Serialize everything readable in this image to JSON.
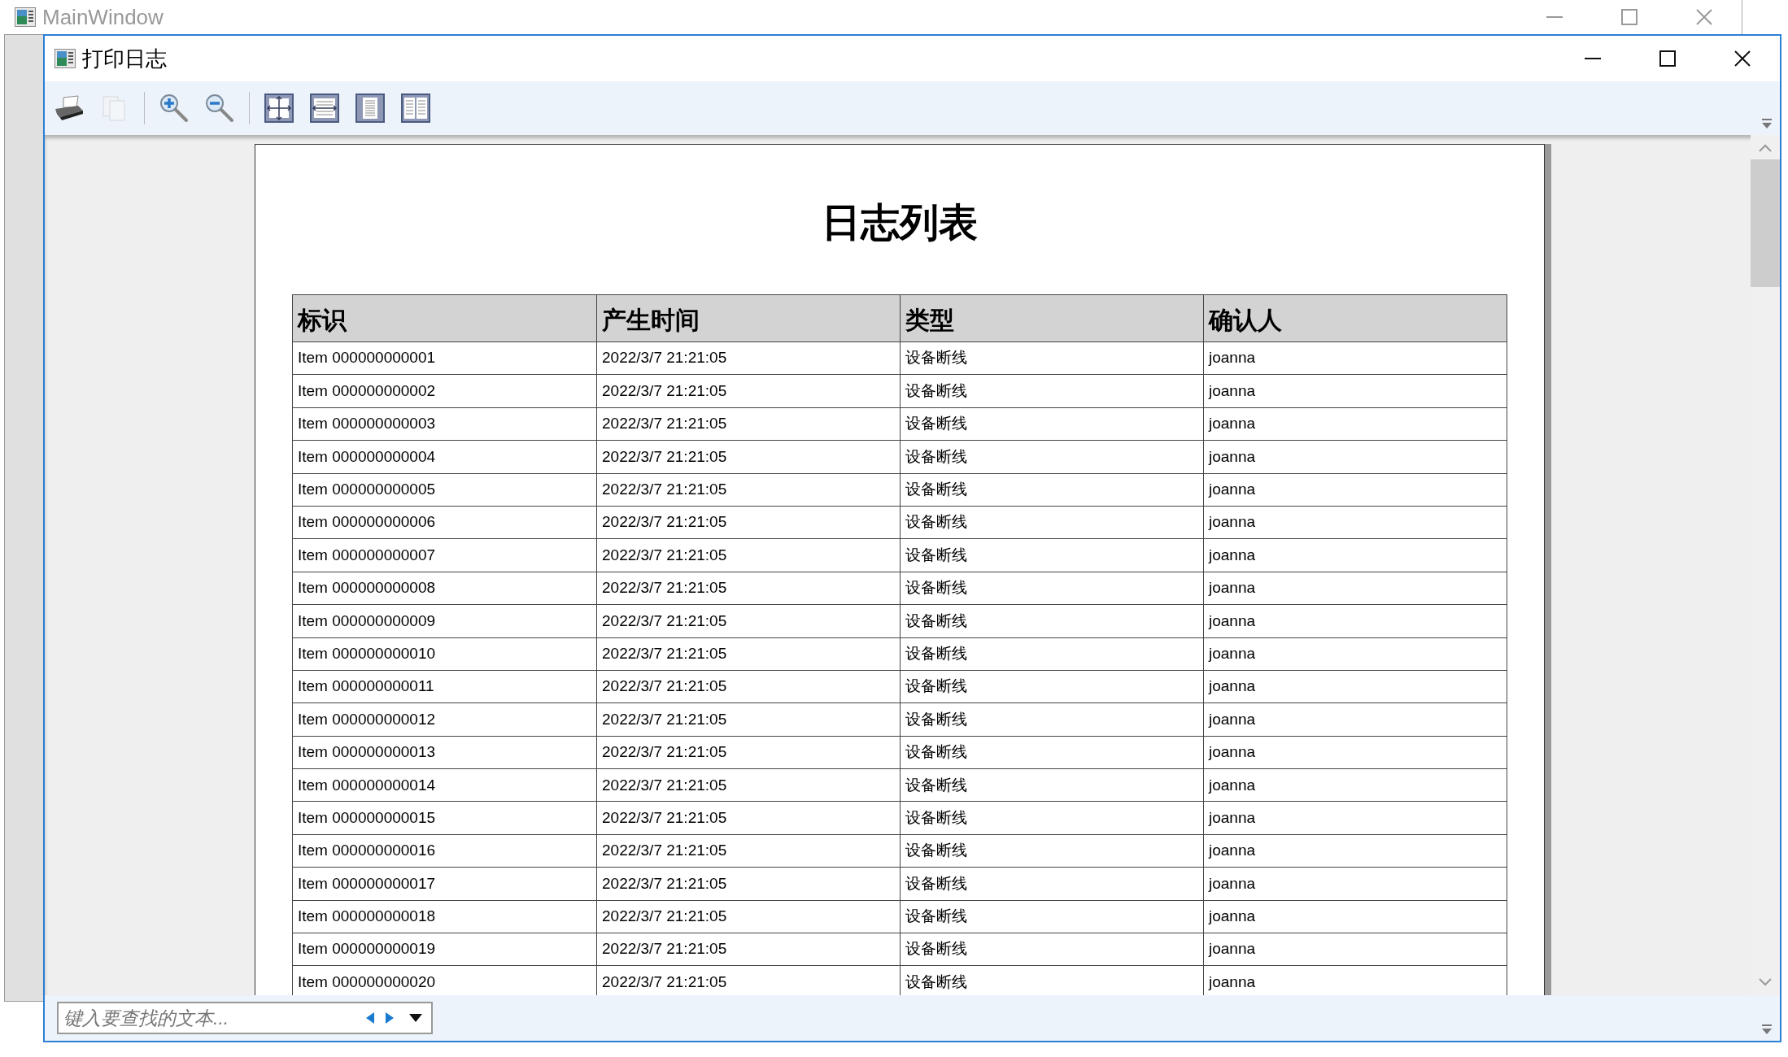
{
  "main_window": {
    "title": "MainWindow"
  },
  "window": {
    "title": "打印日志"
  },
  "toolbar": [
    {
      "kind": "print",
      "disabled": false
    },
    {
      "kind": "copy",
      "disabled": true
    },
    {
      "kind": "separator"
    },
    {
      "kind": "zoom-in",
      "disabled": false
    },
    {
      "kind": "zoom-out",
      "disabled": false
    },
    {
      "kind": "separator"
    },
    {
      "kind": "whole-page",
      "disabled": false
    },
    {
      "kind": "page-width",
      "disabled": false
    },
    {
      "kind": "one-page",
      "disabled": false
    },
    {
      "kind": "two-pages",
      "disabled": false
    }
  ],
  "document": {
    "title": "日志列表",
    "table": {
      "columns": [
        "标识",
        "产生时间",
        "类型",
        "确认人"
      ],
      "rows": [
        [
          "Item 000000000001",
          "2022/3/7 21:21:05",
          "设备断线",
          "joanna"
        ],
        [
          "Item 000000000002",
          "2022/3/7 21:21:05",
          "设备断线",
          "joanna"
        ],
        [
          "Item 000000000003",
          "2022/3/7 21:21:05",
          "设备断线",
          "joanna"
        ],
        [
          "Item 000000000004",
          "2022/3/7 21:21:05",
          "设备断线",
          "joanna"
        ],
        [
          "Item 000000000005",
          "2022/3/7 21:21:05",
          "设备断线",
          "joanna"
        ],
        [
          "Item 000000000006",
          "2022/3/7 21:21:05",
          "设备断线",
          "joanna"
        ],
        [
          "Item 000000000007",
          "2022/3/7 21:21:05",
          "设备断线",
          "joanna"
        ],
        [
          "Item 000000000008",
          "2022/3/7 21:21:05",
          "设备断线",
          "joanna"
        ],
        [
          "Item 000000000009",
          "2022/3/7 21:21:05",
          "设备断线",
          "joanna"
        ],
        [
          "Item 000000000010",
          "2022/3/7 21:21:05",
          "设备断线",
          "joanna"
        ],
        [
          "Item 000000000011",
          "2022/3/7 21:21:05",
          "设备断线",
          "joanna"
        ],
        [
          "Item 000000000012",
          "2022/3/7 21:21:05",
          "设备断线",
          "joanna"
        ],
        [
          "Item 000000000013",
          "2022/3/7 21:21:05",
          "设备断线",
          "joanna"
        ],
        [
          "Item 000000000014",
          "2022/3/7 21:21:05",
          "设备断线",
          "joanna"
        ],
        [
          "Item 000000000015",
          "2022/3/7 21:21:05",
          "设备断线",
          "joanna"
        ],
        [
          "Item 000000000016",
          "2022/3/7 21:21:05",
          "设备断线",
          "joanna"
        ],
        [
          "Item 000000000017",
          "2022/3/7 21:21:05",
          "设备断线",
          "joanna"
        ],
        [
          "Item 000000000018",
          "2022/3/7 21:21:05",
          "设备断线",
          "joanna"
        ],
        [
          "Item 000000000019",
          "2022/3/7 21:21:05",
          "设备断线",
          "joanna"
        ],
        [
          "Item 000000000020",
          "2022/3/7 21:21:05",
          "设备断线",
          "joanna"
        ]
      ]
    }
  },
  "find_bar": {
    "placeholder": "键入要查找的文本..."
  }
}
